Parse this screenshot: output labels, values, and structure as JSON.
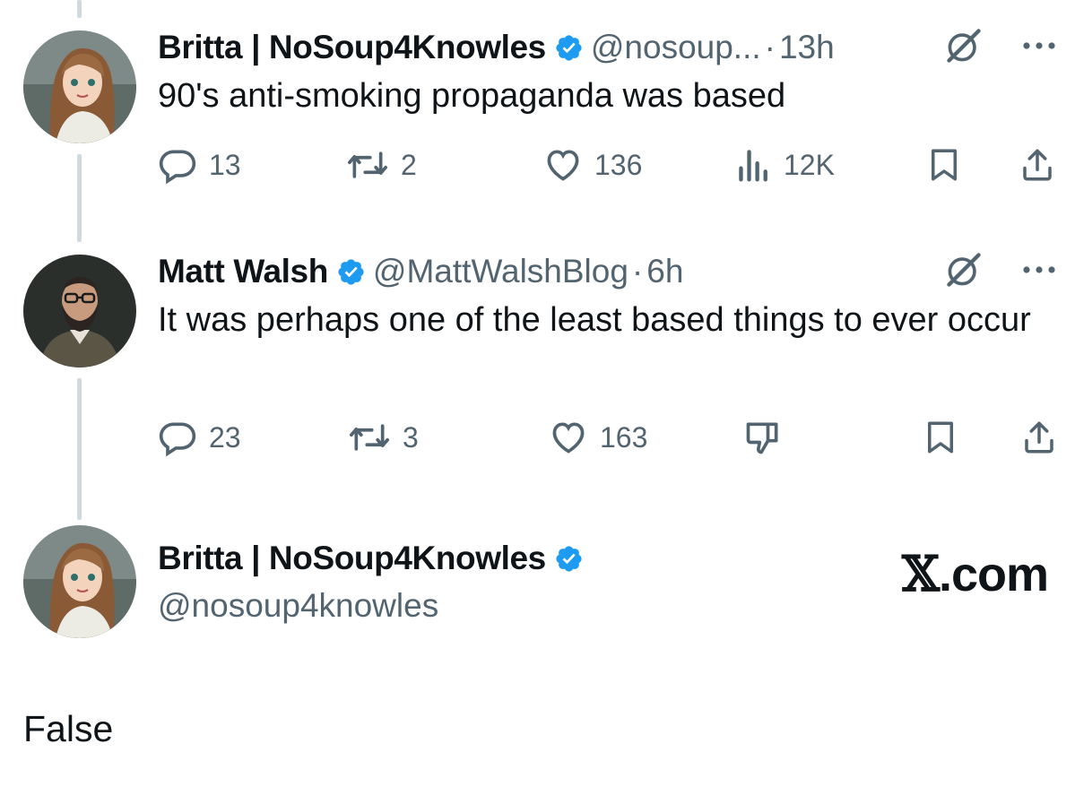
{
  "tweets": [
    {
      "name": "Britta | NoSoup4Knowles",
      "handle": "@nosoup...",
      "separator": "·",
      "time": "13h",
      "text": "90's anti-smoking propaganda was based",
      "stats": {
        "replies": "13",
        "reposts": "2",
        "likes": "136",
        "views": "12K"
      }
    },
    {
      "name": "Matt Walsh",
      "handle": "@MattWalshBlog",
      "separator": "·",
      "time": "6h",
      "text": "It was perhaps one of the least based things to ever occur",
      "stats": {
        "replies": "23",
        "reposts": "3",
        "likes": "163"
      }
    }
  ],
  "reply": {
    "name": "Britta | NoSoup4Knowles",
    "handle": "@nosoup4knowles",
    "text": "False"
  },
  "brand": {
    "x": "𝕏",
    "suffix": ".com"
  },
  "colors": {
    "verified": "#1d9bf0",
    "muted": "#536471",
    "thread": "#cfd9de"
  },
  "icons": [
    "verified-badge-icon",
    "grok-icon",
    "more-icon",
    "reply-icon",
    "repost-icon",
    "like-icon",
    "views-icon",
    "dislike-icon",
    "bookmark-icon",
    "share-icon"
  ]
}
